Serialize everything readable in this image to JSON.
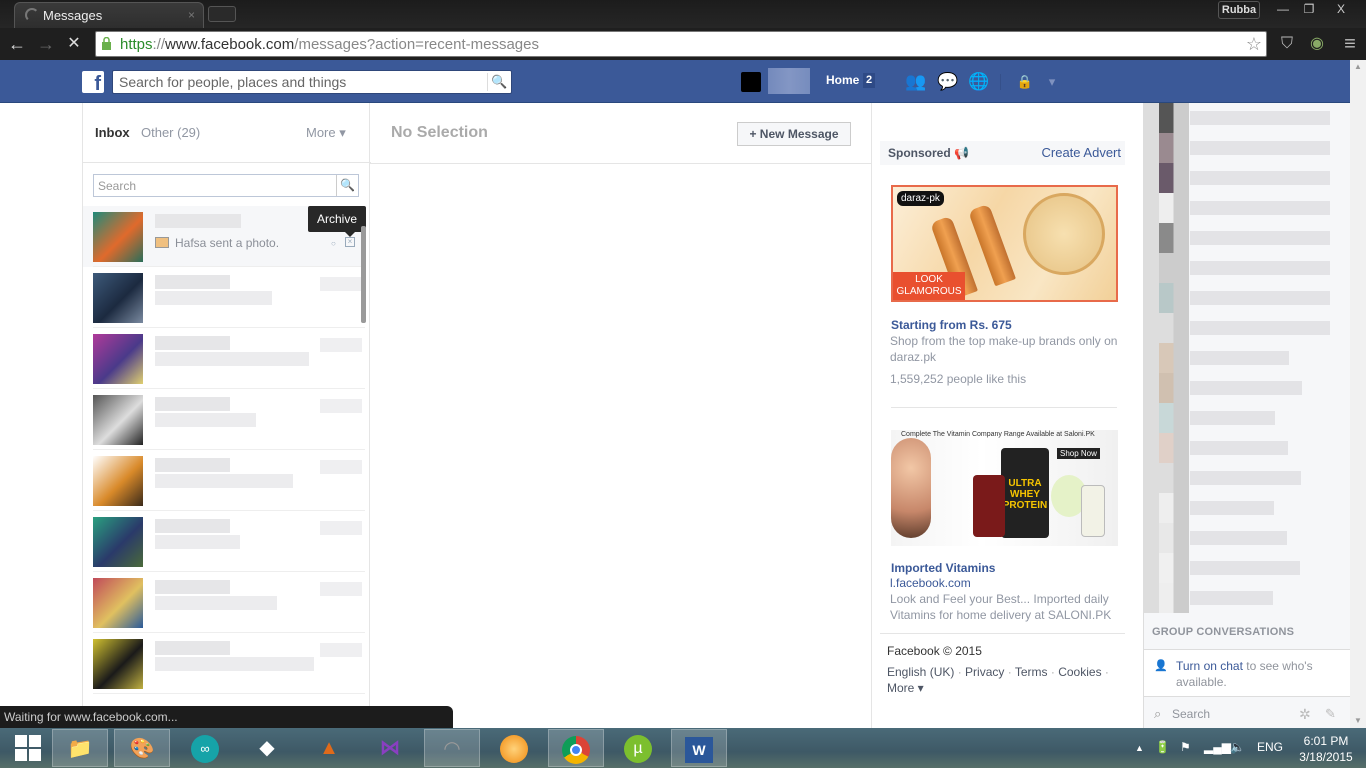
{
  "browser": {
    "tab_title": "Messages",
    "tab_close": "×",
    "profile_name": "Rubba",
    "window_controls": {
      "minimize": "—",
      "restore": "❐",
      "close": "X"
    },
    "url_scheme": "https",
    "url_sep": "://",
    "url_host": "www.facebook.com",
    "url_path": "/messages?action=recent-messages",
    "nav": {
      "back": "←",
      "forward": "→",
      "stop": "✕"
    },
    "star_icon": "☆",
    "extensions": {
      "shield": "⛉",
      "color": "◉",
      "menu": "≡"
    },
    "status_text": "Waiting for www.facebook.com..."
  },
  "fb_header": {
    "logo": "f",
    "search_placeholder": "Search for people, places and things",
    "search_icon": "🔍",
    "home_label": "Home",
    "home_count": "2",
    "jewels": {
      "friends": "👥",
      "messages": "💬",
      "notifications": "🌐",
      "privacy": "🔒",
      "menu_arrow": "▾"
    }
  },
  "messages": {
    "tabs": {
      "inbox": "Inbox",
      "other": "Other (29)",
      "more": "More ▾"
    },
    "search_placeholder": "Search",
    "search_icon": "🔍",
    "threads": [
      {
        "snippet": "Hafsa sent a photo.",
        "active": true,
        "avatar_colors": [
          "#1f8a7a",
          "#e06a2c",
          "#2a6e5a"
        ]
      },
      {
        "snippet": "",
        "active": false,
        "avatar_colors": [
          "#3d5a7a",
          "#1c2a40",
          "#7a8aa0"
        ]
      },
      {
        "snippet": "",
        "active": false,
        "avatar_colors": [
          "#b03a9a",
          "#4a3a8a",
          "#e0d070"
        ]
      },
      {
        "snippet": "",
        "active": false,
        "avatar_colors": [
          "#555",
          "#ddd",
          "#222"
        ]
      },
      {
        "snippet": "",
        "active": false,
        "avatar_colors": [
          "#fff",
          "#d98a2a",
          "#3a2a1a"
        ]
      },
      {
        "snippet": "",
        "active": false,
        "avatar_colors": [
          "#2aa080",
          "#2a3a6a",
          "#4a6a3a"
        ]
      },
      {
        "snippet": "",
        "active": false,
        "avatar_colors": [
          "#c04a5a",
          "#e0c060",
          "#2a5a9a"
        ]
      },
      {
        "snippet": "",
        "active": false,
        "avatar_colors": [
          "#d0c030",
          "#1a1a1a",
          "#c0b040"
        ]
      }
    ],
    "tooltip": "Archive",
    "no_selection": "No Selection",
    "new_message": "+ New Message"
  },
  "ads": {
    "sponsored_label": "Sponsored",
    "create_advert": "Create Advert",
    "ad1": {
      "brand_badge": "daraz-pk",
      "banner_text": "LOOK GLAMOROUS",
      "title": "Starting from Rs. 675",
      "description": "Shop from the top make-up brands only on daraz.pk",
      "likes": "1,559,252 people like this"
    },
    "ad2": {
      "banner_caption": "Complete The Vitamin Company Range Available at Saloni.PK",
      "shop_now": "Shop Now",
      "product_text": "ULTRA WHEY PROTEIN",
      "title": "Imported Vitamins",
      "domain": "l.facebook.com",
      "description": "Look and Feel your Best... Imported daily Vitamins for home delivery at SALONI.PK"
    },
    "footer": {
      "copyright": "Facebook © 2015",
      "links": [
        "English (UK)",
        "Privacy",
        "Terms",
        "Cookies",
        "More ▾"
      ]
    }
  },
  "chat": {
    "group_conversations": "GROUP CONVERSATIONS",
    "turn_on_link": "Turn on chat",
    "turn_on_rest": " to see who's available.",
    "search_placeholder": "Search",
    "gear_icon": "✲",
    "compose_icon": "✎"
  },
  "taskbar": {
    "apps": [
      "Start",
      "File Explorer",
      "Paint",
      "Arduino",
      "Unity",
      "MATLAB",
      "Visual Studio",
      "Photo Editor",
      "GOM Player",
      "Chrome",
      "uTorrent",
      "Word"
    ],
    "language": "ENG",
    "time": "6:01 PM",
    "date": "3/18/2015"
  }
}
